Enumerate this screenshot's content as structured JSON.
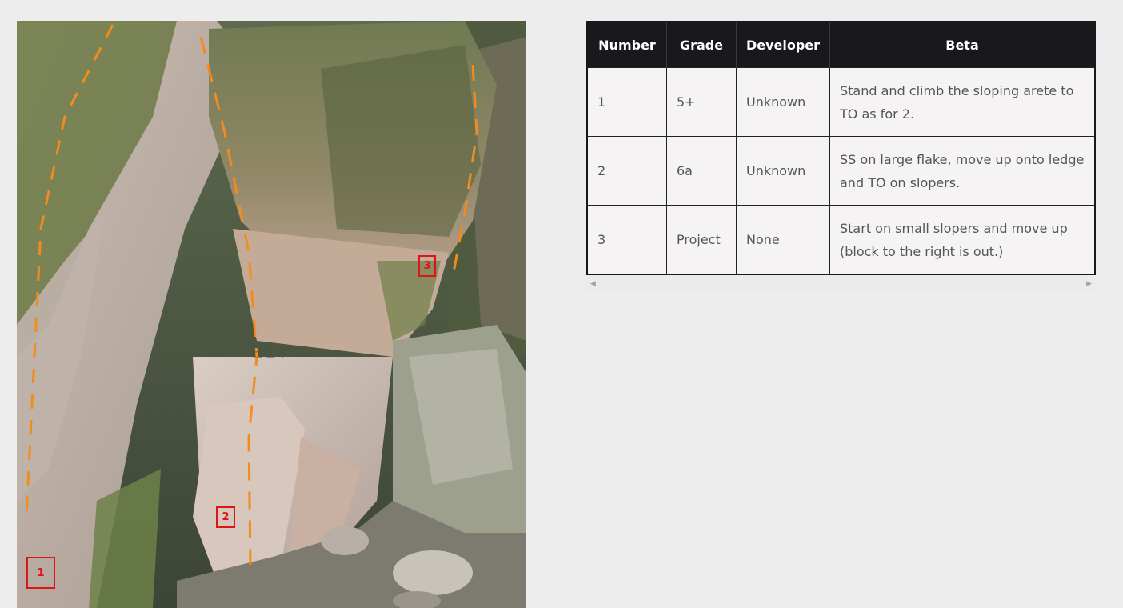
{
  "photo": {
    "watermark": "BCT",
    "markers": [
      "1",
      "2",
      "3"
    ]
  },
  "table": {
    "headers": {
      "number": "Number",
      "grade": "Grade",
      "developer": "Developer",
      "beta": "Beta"
    },
    "rows": [
      {
        "number": "1",
        "grade": "5+",
        "developer": "Unknown",
        "beta": "Stand and climb the sloping arete to TO as for 2."
      },
      {
        "number": "2",
        "grade": "6a",
        "developer": "Unknown",
        "beta": "SS on large flake, move up onto ledge and TO on slopers."
      },
      {
        "number": "3",
        "grade": "Project",
        "developer": "None",
        "beta": "Start on small slopers and move up (block to the right is out.)"
      }
    ]
  },
  "scrollbar": {
    "left_icon": "triangle-left-icon",
    "right_icon": "triangle-right-icon",
    "left_glyph": "◀",
    "right_glyph": "▶"
  },
  "colors": {
    "header_bg": "#19181c",
    "marker": "#e01414",
    "route_line": "#f28c1e"
  }
}
